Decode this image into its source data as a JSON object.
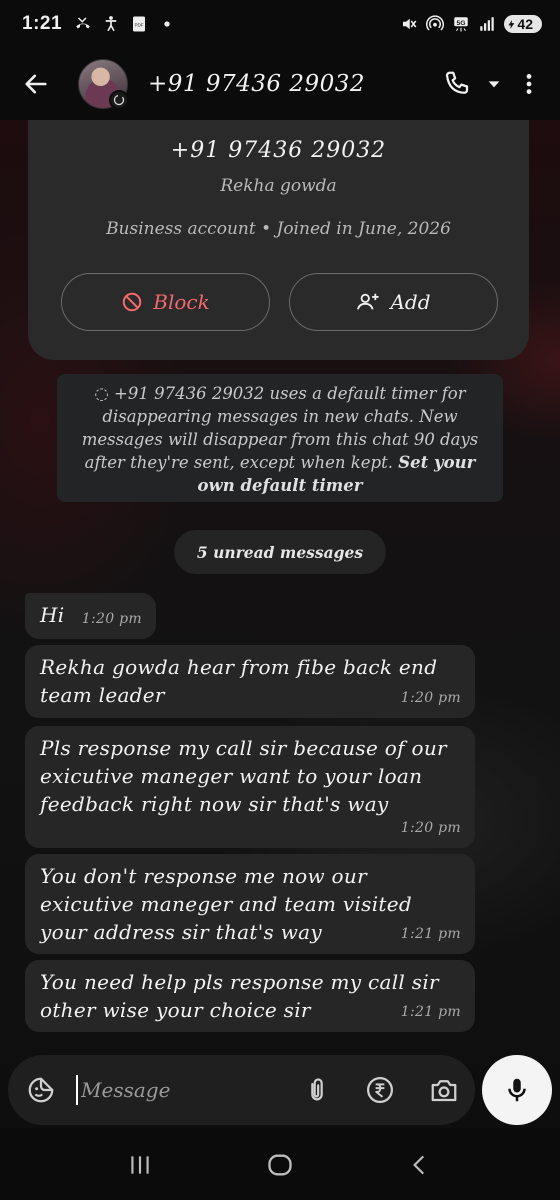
{
  "status_bar": {
    "time": "1:21",
    "network": "5G",
    "battery": "42",
    "icons": [
      "missed-call-icon",
      "accessibility-icon",
      "pdf-notification-icon",
      "dot-icon",
      "mute-icon",
      "hotspot-icon",
      "5g-icon",
      "signal-icon",
      "battery-icon"
    ]
  },
  "header": {
    "back_icon": "arrow-left-icon",
    "contact_name": "+91 97436 29032",
    "actions": [
      "phone-icon",
      "chevron-down-icon",
      "more-vert-icon"
    ]
  },
  "info_card": {
    "number": "+91 97436 29032",
    "name": "Rekha gowda",
    "meta": "Business account • Joined in June, 2026",
    "block_label": "Block",
    "add_label": "Add"
  },
  "system_note": {
    "text": "+91 97436 29032 uses a default timer for disappearing messages in new chats. New messages will disappear from this chat 90 days after they're sent, except when kept.",
    "link": "Set your own default timer"
  },
  "unread": "5 unread messages",
  "messages": [
    {
      "text": "Hi",
      "time": "1:20 pm"
    },
    {
      "text": "Rekha gowda hear from fibe back end team leader",
      "time": "1:20 pm"
    },
    {
      "text": "Pls response my call sir because of our exicutive maneger want to your loan feedback right now sir that's way",
      "time": "1:20 pm"
    },
    {
      "text": "You don't response me now our exicutive maneger and team visited your address sir that's way",
      "time": "1:21 pm"
    },
    {
      "text": "You need help pls response my call sir other wise your choice sir",
      "time": "1:21 pm"
    }
  ],
  "input": {
    "placeholder": "Message",
    "value": ""
  },
  "nav": [
    "recents-icon",
    "home-icon",
    "back-icon"
  ]
}
